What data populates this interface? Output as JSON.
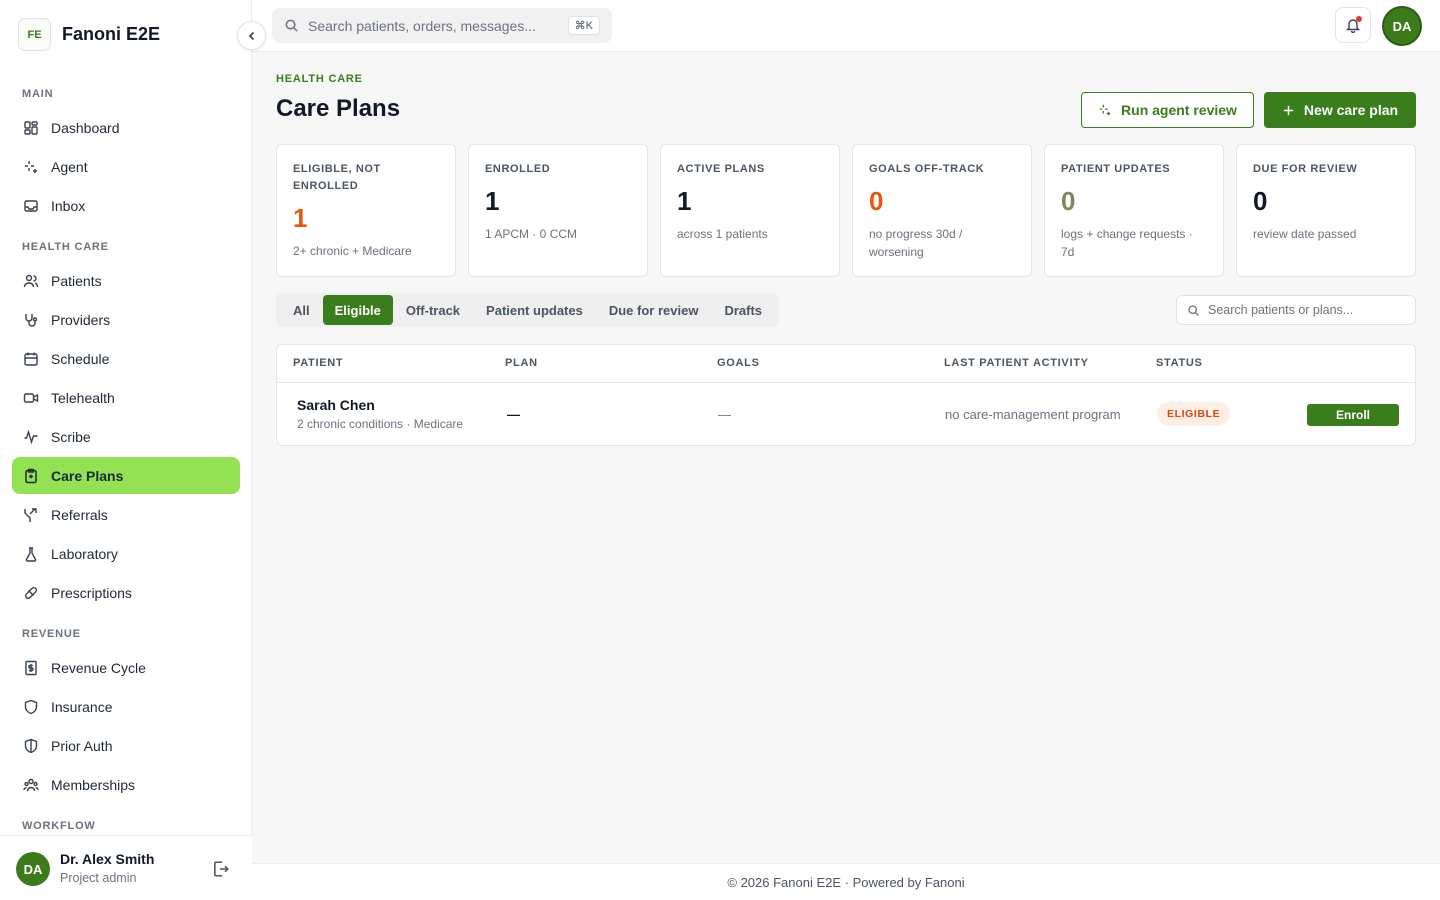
{
  "app": {
    "badge": "FE",
    "name": "Fanoni E2E"
  },
  "sidebar": {
    "sections": [
      {
        "title": "MAIN",
        "items": [
          {
            "label": "Dashboard",
            "icon": "dashboard-icon"
          },
          {
            "label": "Agent",
            "icon": "sparkles-icon"
          },
          {
            "label": "Inbox",
            "icon": "inbox-icon"
          }
        ]
      },
      {
        "title": "HEALTH CARE",
        "items": [
          {
            "label": "Patients",
            "icon": "users-icon"
          },
          {
            "label": "Providers",
            "icon": "stethoscope-icon"
          },
          {
            "label": "Schedule",
            "icon": "calendar-icon"
          },
          {
            "label": "Telehealth",
            "icon": "video-icon"
          },
          {
            "label": "Scribe",
            "icon": "waveform-icon"
          },
          {
            "label": "Care Plans",
            "icon": "clipboard-icon",
            "active": true
          },
          {
            "label": "Referrals",
            "icon": "split-arrow-icon"
          },
          {
            "label": "Laboratory",
            "icon": "flask-icon"
          },
          {
            "label": "Prescriptions",
            "icon": "pill-icon"
          }
        ]
      },
      {
        "title": "REVENUE",
        "items": [
          {
            "label": "Revenue Cycle",
            "icon": "receipt-icon"
          },
          {
            "label": "Insurance",
            "icon": "shield-icon"
          },
          {
            "label": "Prior Auth",
            "icon": "shield-half-icon"
          },
          {
            "label": "Memberships",
            "icon": "group-icon"
          }
        ]
      },
      {
        "title": "WORKFLOW",
        "items": []
      }
    ],
    "user": {
      "initials": "DA",
      "name": "Dr. Alex Smith",
      "role": "Project admin"
    }
  },
  "topbar": {
    "search_placeholder": "Search patients, orders, messages...",
    "shortcut": "⌘K",
    "avatar": "DA"
  },
  "page": {
    "eyebrow": "HEALTH CARE",
    "title": "Care Plans",
    "agent_button": "Run agent review",
    "new_button": "New care plan"
  },
  "stats": [
    {
      "label": "ELIGIBLE, NOT ENROLLED",
      "value": "1",
      "sub": "2+ chronic + Medicare",
      "color": "#e8590c"
    },
    {
      "label": "ENROLLED",
      "value": "1",
      "sub": "1 APCM · 0 CCM",
      "color": "#111827"
    },
    {
      "label": "ACTIVE PLANS",
      "value": "1",
      "sub": "across 1 patients",
      "color": "#111827"
    },
    {
      "label": "GOALS OFF-TRACK",
      "value": "0",
      "sub": "no progress 30d / worsening",
      "color": "#e8590c"
    },
    {
      "label": "PATIENT UPDATES",
      "value": "0",
      "sub": "logs + change requests · 7d",
      "color": "#7a8a5a"
    },
    {
      "label": "DUE FOR REVIEW",
      "value": "0",
      "sub": "review date passed",
      "color": "#111827"
    }
  ],
  "filters": {
    "tabs": [
      "All",
      "Eligible",
      "Off-track",
      "Patient updates",
      "Due for review",
      "Drafts"
    ],
    "active": "Eligible",
    "search_placeholder": "Search patients or plans..."
  },
  "table": {
    "columns": [
      "PATIENT",
      "PLAN",
      "GOALS",
      "LAST PATIENT ACTIVITY",
      "STATUS"
    ],
    "rows": [
      {
        "name": "Sarah Chen",
        "sub": "2 chronic conditions · Medicare",
        "plan": "—",
        "goals": "—",
        "activity": "no care-management program",
        "status": "ELIGIBLE",
        "action": "Enroll"
      }
    ]
  },
  "footer": {
    "text": "© 2026 Fanoni E2E · Powered by Fanoni"
  }
}
